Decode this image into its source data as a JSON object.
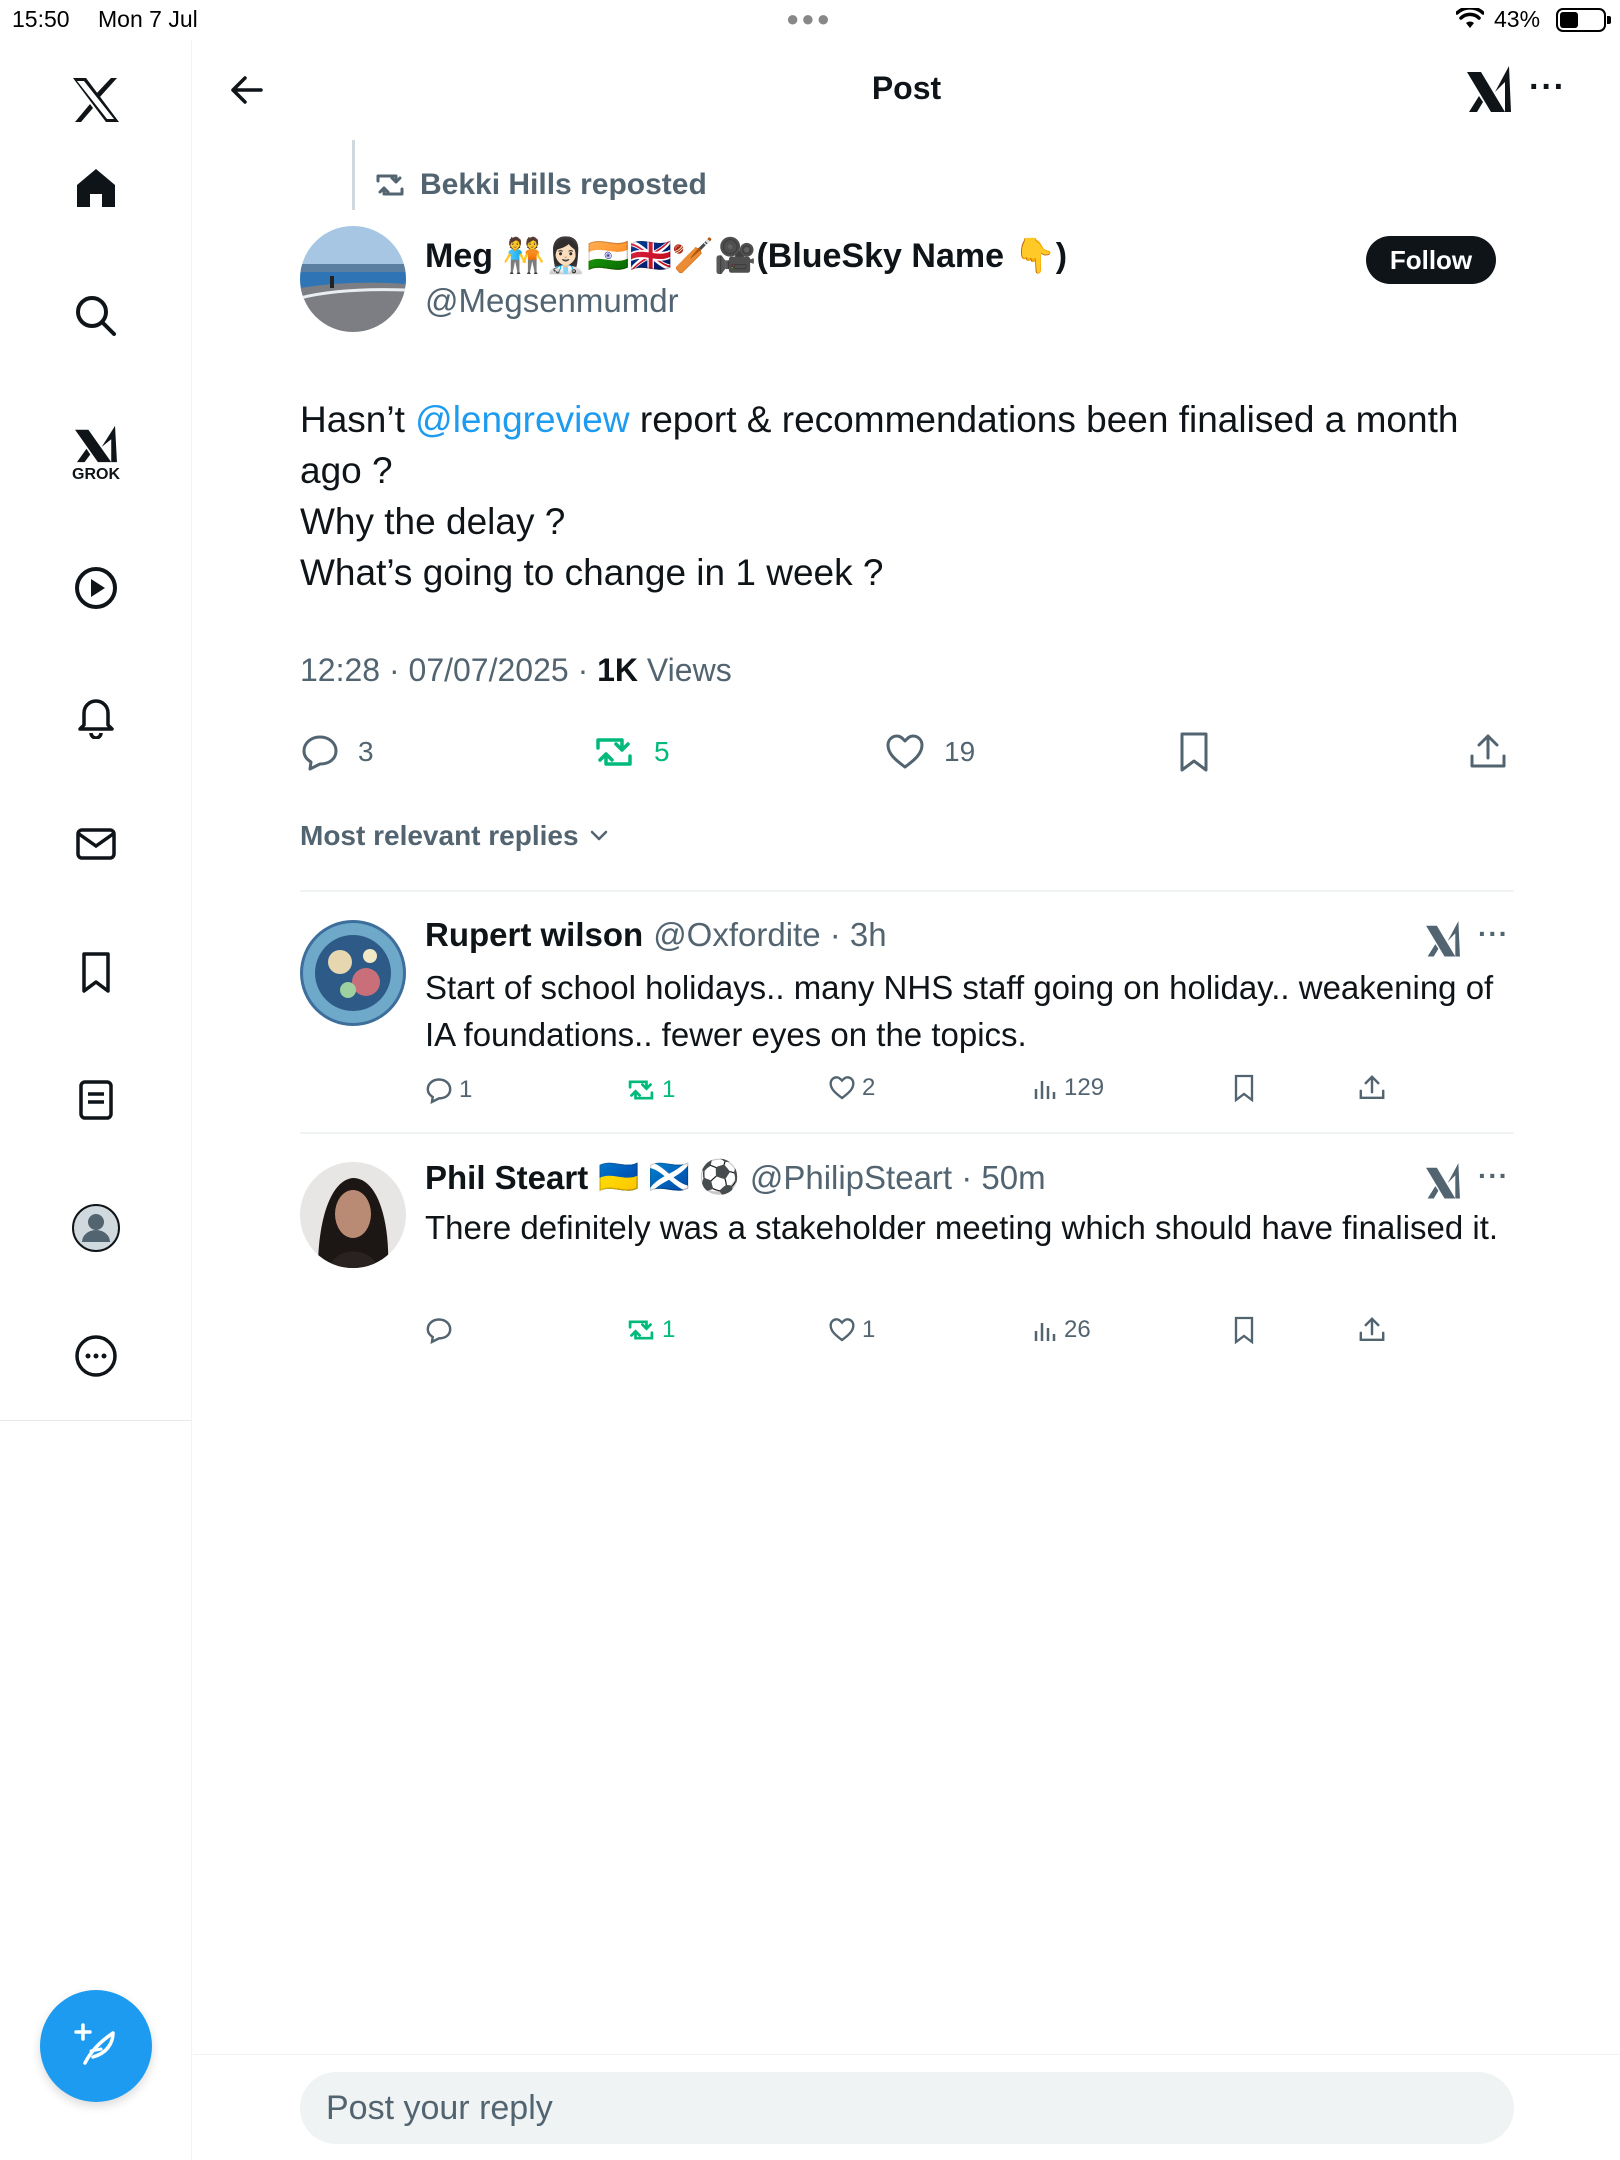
{
  "status_bar": {
    "time": "15:50",
    "date": "Mon 7 Jul",
    "battery": "43%"
  },
  "header": {
    "title": "Post"
  },
  "post": {
    "repost_label": "Bekki Hills reposted",
    "author_name": "Meg 🧑‍🤝‍🧑👩🏻‍⚕️🇮🇳🇬🇧🏏🎥(BlueSky Name 👇)",
    "author_handle": "@Megsenmumdr",
    "follow_label": "Follow",
    "text_prefix": "Hasn’t ",
    "mention": "@lengreview",
    "text_line1_rest": " report & recommendations been finalised a month ago ?",
    "text_line2": "Why the delay ?",
    "text_line3": "What’s going to change in 1 week ?",
    "timestamp": "12:28 · 07/07/2025 · ",
    "views_count": "1K",
    "views_label": " Views",
    "replies": "3",
    "reposts": "5",
    "likes": "19"
  },
  "replies_sort": "Most relevant replies",
  "replies": [
    {
      "name": "Rupert wilson",
      "handle": "@Oxfordite · 3h",
      "text": "Start of school holidays.. many NHS staff going on holiday.. weakening of IA foundations.. fewer eyes on the topics.",
      "reply_count": "1",
      "repost_count": "1",
      "like_count": "2",
      "view_count": "129"
    },
    {
      "name": "Phil Steart",
      "flags": "🇺🇦 🏴󠁧󠁢󠁳󠁣󠁴󠁿 ⚽",
      "handle": "@PhilipSteart · 50m",
      "text": "There definitely was a stakeholder meeting which should have finalised it.",
      "reply_count": "",
      "repost_count": "1",
      "like_count": "1",
      "view_count": "26"
    }
  ],
  "reply_bar": {
    "placeholder": "Post your reply"
  },
  "colors": {
    "accent": "#1d9bf0",
    "repost_green": "#00ba7c",
    "secondary_text": "#536471"
  },
  "sidebar_icons": [
    "x-logo-icon",
    "home-icon",
    "search-icon",
    "grok-icon",
    "video-icon",
    "notifications-icon",
    "messages-icon",
    "bookmarks-icon",
    "lists-icon",
    "profile-icon",
    "more-icon"
  ],
  "sidebar": {
    "grok_label": "GROK"
  }
}
